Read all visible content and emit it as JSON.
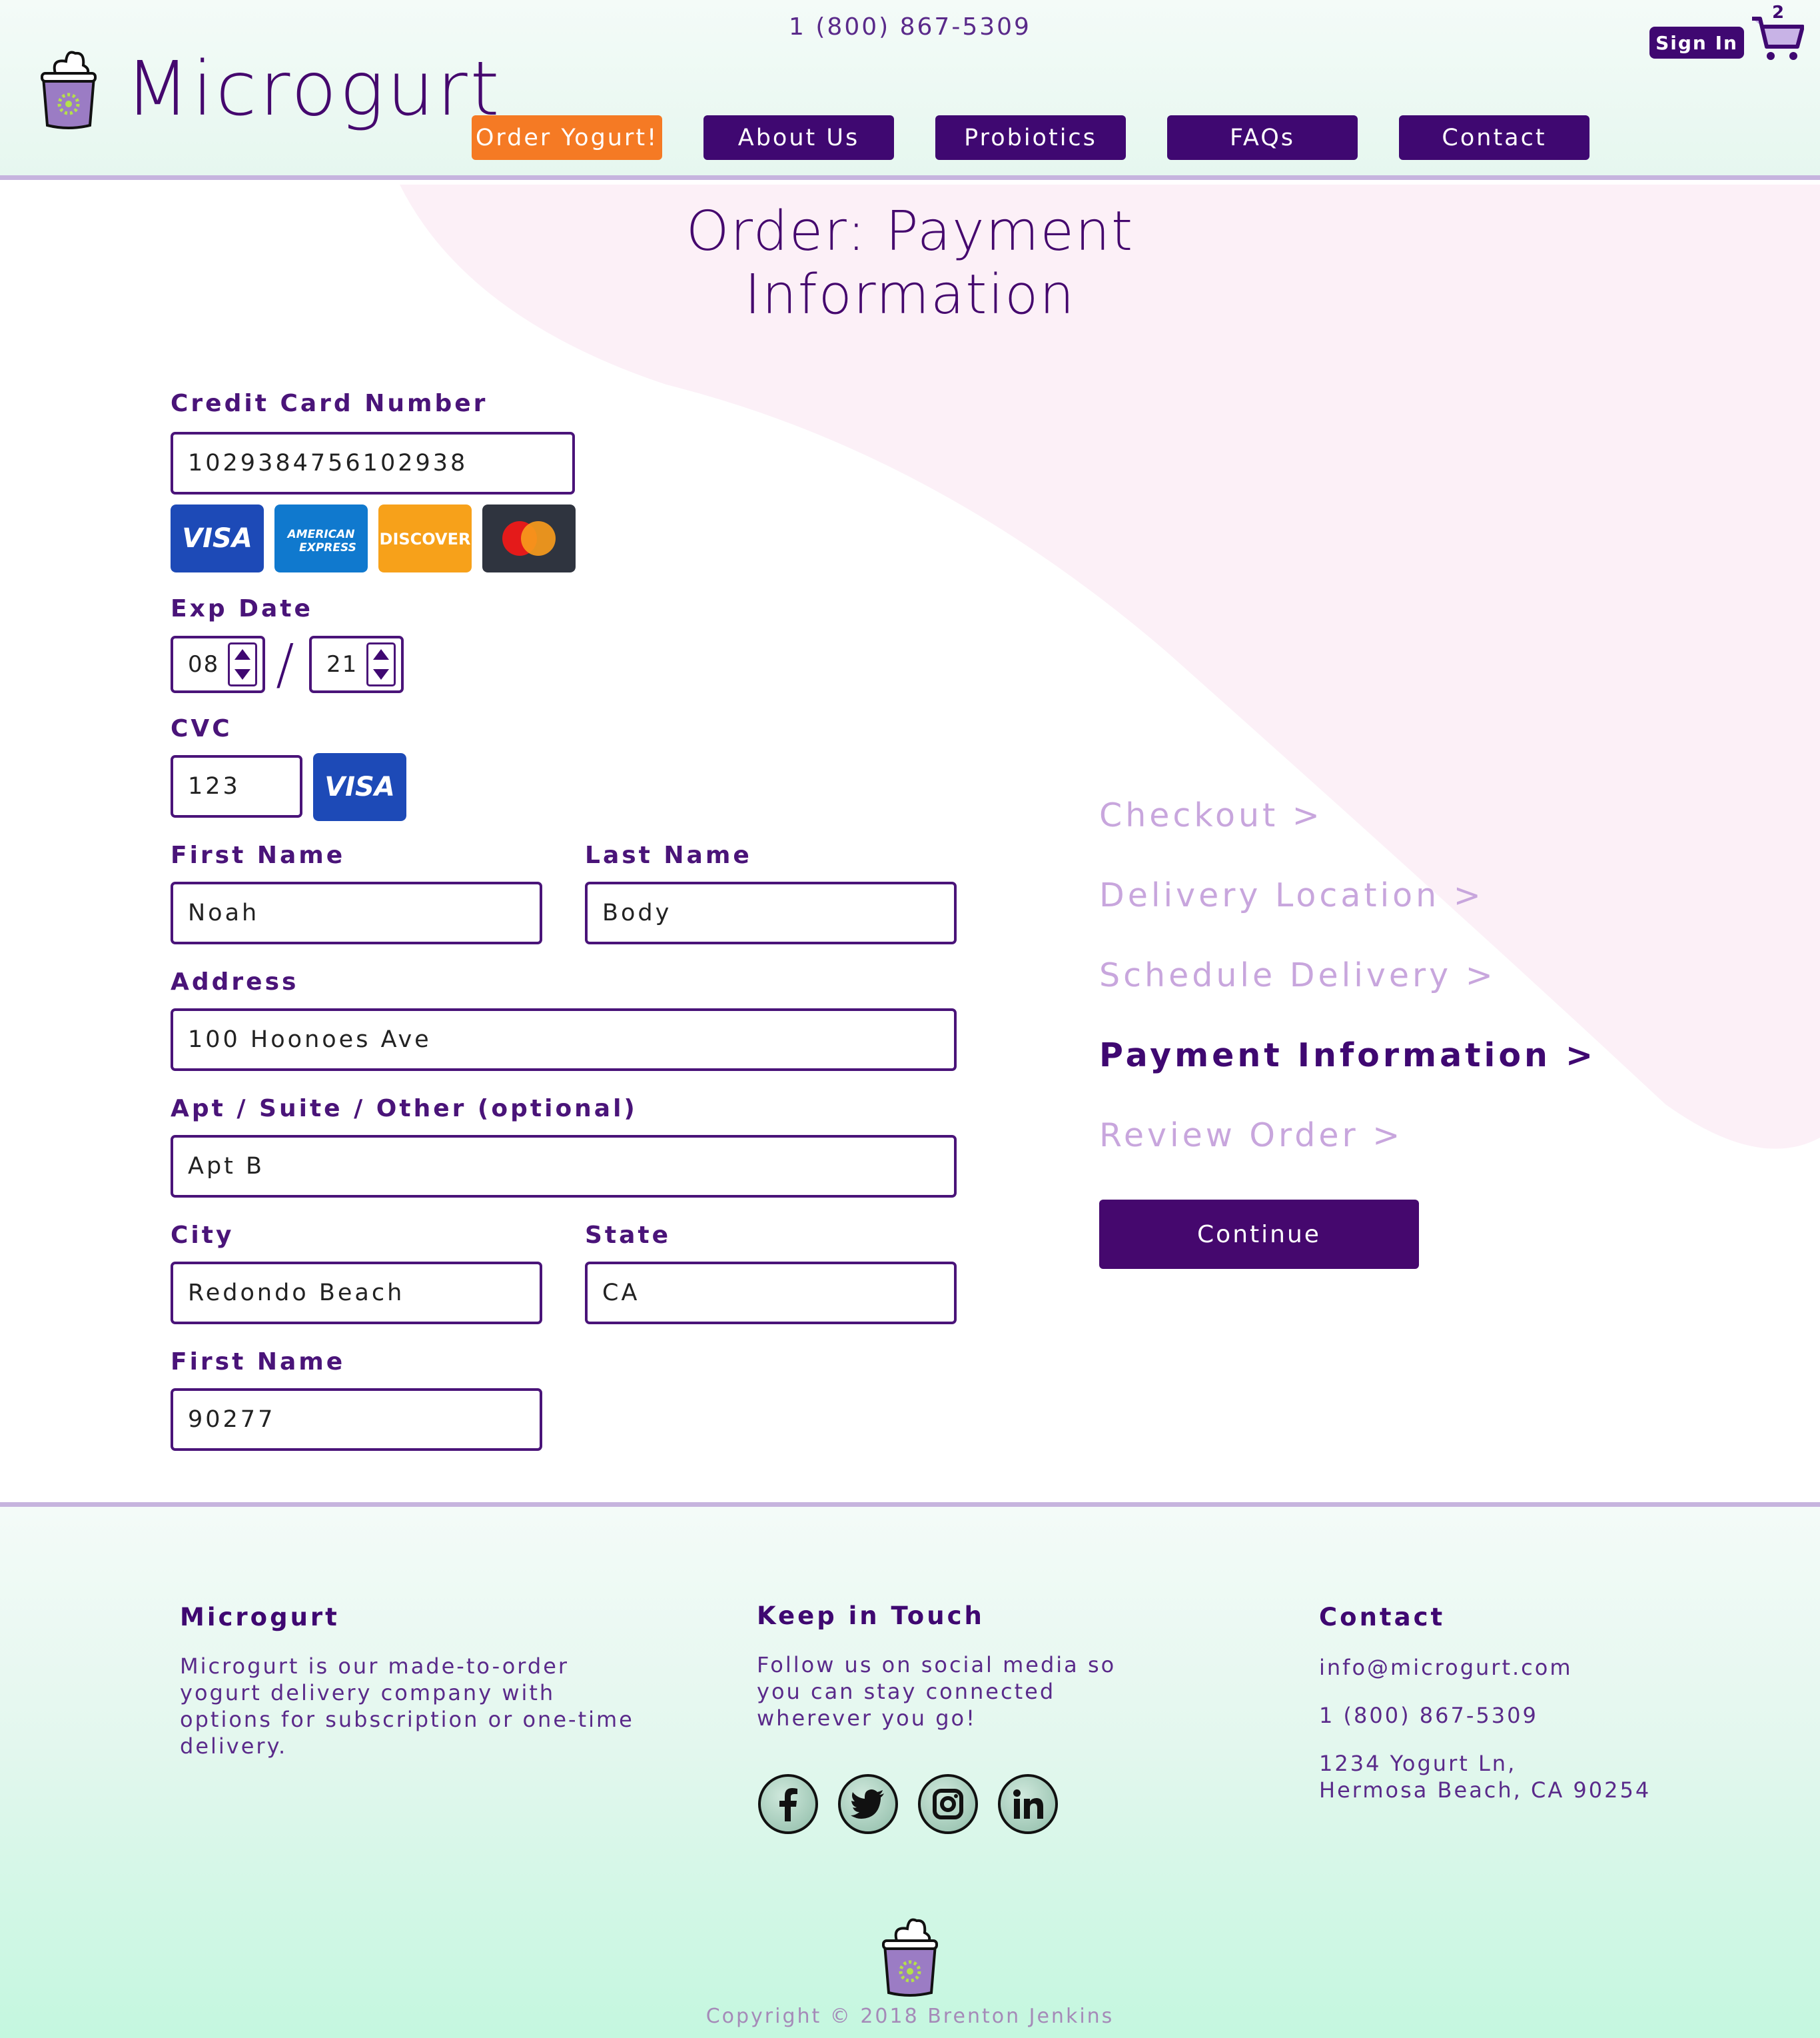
{
  "header": {
    "phone": "1 (800) 867-5309",
    "brand": "Microgurt",
    "sign_in": "Sign In",
    "cart_count": "2",
    "nav": [
      "Order Yogurt!",
      "About Us",
      "Probiotics",
      "FAQs",
      "Contact"
    ]
  },
  "page": {
    "title": "Order: Payment Information"
  },
  "form": {
    "card_number_label": "Credit Card Number",
    "card_number_value": "1029384756102938",
    "card_brands": [
      "VISA",
      "AMERICAN EXPRESS",
      "DISCOVER",
      "mastercard"
    ],
    "exp_label": "Exp Date",
    "exp_month": "08",
    "exp_slash": "/",
    "exp_year": "21",
    "cvc_label": "CVC",
    "cvc_value": "123",
    "cvc_brand": "VISA",
    "first_name_label": "First Name",
    "first_name_value": "Noah",
    "last_name_label": "Last Name",
    "last_name_value": "Body",
    "address_label": "Address",
    "address_value": "100 Hoonoes Ave",
    "apt_label": "Apt / Suite / Other (optional)",
    "apt_value": "Apt B",
    "city_label": "City",
    "city_value": "Redondo Beach",
    "state_label": "State",
    "state_value": "CA",
    "zip_label": "First Name",
    "zip_value": "90277"
  },
  "steps": {
    "items": [
      "Checkout >",
      "Delivery Location >",
      "Schedule Delivery >",
      "Payment Information >",
      "Review Order >"
    ],
    "active_index": 3,
    "continue": "Continue"
  },
  "footer": {
    "about_title": "Microgurt",
    "about_text": "Microgurt is our made-to-order yogurt delivery company with options for subscription or one-time delivery.",
    "social_title": "Keep in Touch",
    "social_text": "Follow us on social media so you can stay connected wherever you go!",
    "social_icons": [
      "facebook-icon",
      "twitter-icon",
      "instagram-icon",
      "linkedin-icon"
    ],
    "contact_title": "Contact",
    "email": "info@microgurt.com",
    "phone": "1 (800) 867-5309",
    "address_line1": "1234 Yogurt Ln,",
    "address_line2": "Hermosa Beach, CA 90254",
    "copyright": "Copyright © 2018 Brenton Jenkins"
  },
  "colors": {
    "brand_purple": "#3f0871",
    "accent_orange": "#f57a24",
    "inactive_step": "#c8a6dd",
    "divider": "#c6b4de"
  }
}
